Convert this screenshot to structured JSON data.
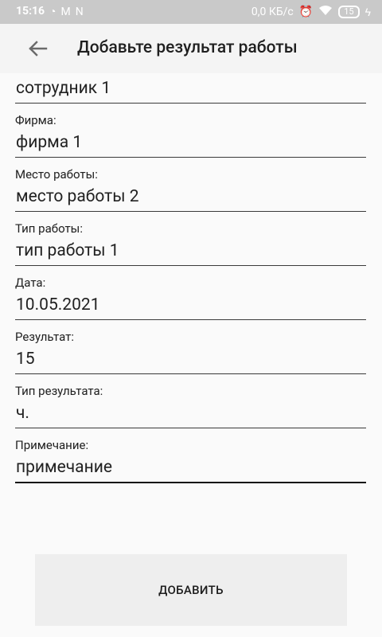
{
  "status_bar": {
    "time": "15:16",
    "left_icons": [
      "whatsapp-icon",
      "gmail-icon",
      "n-icon"
    ],
    "network_speed": "0,0 КБ/с",
    "battery": "15",
    "right_icons": [
      "alarm-icon",
      "wifi-icon",
      "battery-icon",
      "charging-icon"
    ]
  },
  "header": {
    "title": "Добавьте результат работы",
    "back_icon": "arrow-left-icon"
  },
  "form": {
    "employee_value": "сотрудник 1",
    "company_label": "Фирма:",
    "company_value": "фирма 1",
    "workplace_label": "Место работы:",
    "workplace_value": "место работы 2",
    "work_type_label": "Тип работы:",
    "work_type_value": "тип работы 1",
    "date_label": "Дата:",
    "date_value": "10.05.2021",
    "result_label": "Результат:",
    "result_value": "15",
    "result_type_label": "Тип результата:",
    "result_type_value": "ч.",
    "note_label": "Примечание:",
    "note_value": "примечание"
  },
  "actions": {
    "add_label": "ДОБАВИТЬ"
  },
  "colors": {
    "status_bar": "#c9c9c9",
    "app_bar": "#f4f4f4",
    "background": "#fafafa",
    "button": "#eeeeee"
  }
}
